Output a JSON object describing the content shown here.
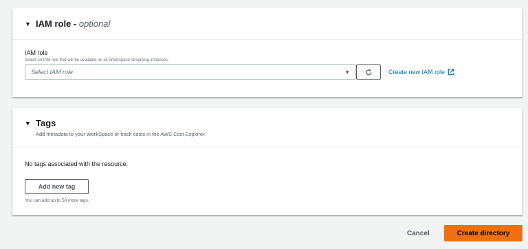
{
  "iam_panel": {
    "title": "IAM role - ",
    "title_optional": "optional",
    "field_label": "IAM role",
    "field_description": "Select an IAM role that will be available on all WorkSpace streaming instances.",
    "select_placeholder": "Select IAM role",
    "create_link": "Create new IAM role",
    "refresh_icon": "refresh-icon",
    "external_icon": "external-link-icon"
  },
  "tags_panel": {
    "title": "Tags",
    "description": "Add metadata to your WorkSpace or track costs in the AWS Cost Explorer.",
    "empty_text": "No tags associated with the resource.",
    "add_button": "Add new tag",
    "limit_text": "You can add up to 50 more tags."
  },
  "footer": {
    "cancel_label": "Cancel",
    "create_label": "Create directory"
  },
  "colors": {
    "accent": "#ec7211",
    "link": "#0073bb",
    "background": "#f2f3f3"
  }
}
